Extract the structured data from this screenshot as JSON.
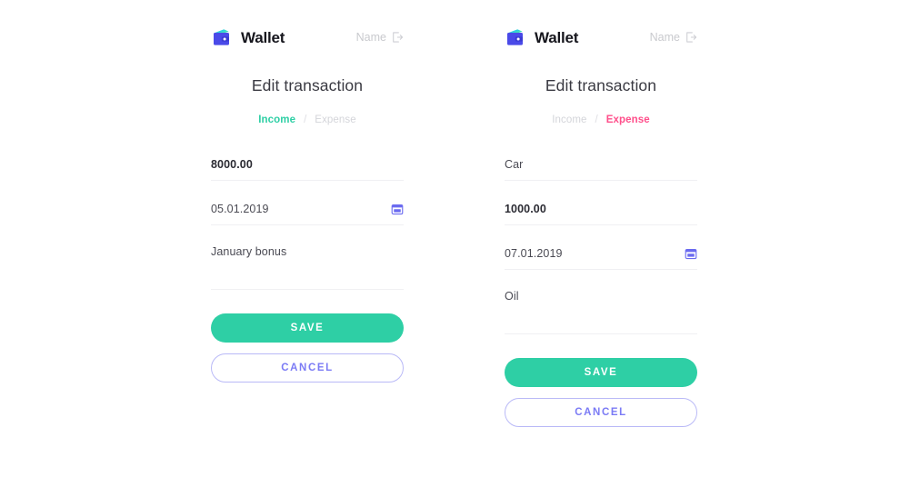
{
  "brand": {
    "name": "Wallet",
    "logo_icon": "wallet-icon"
  },
  "user": {
    "name": "Name",
    "logout_icon": "logout-icon"
  },
  "colors": {
    "income_accent": "#2ecfa5",
    "expense_accent": "#ff4f8b",
    "save_button": "#2ecfa5",
    "cancel_border": "#b9b9f7",
    "cancel_text": "#7b7bf5",
    "calendar_icon": "#6b6bf0",
    "muted_text": "#d4d5da",
    "field_underline": "#f0f0f3"
  },
  "panels": [
    {
      "id": "income-panel",
      "title": "Edit transaction",
      "tabs": [
        {
          "label": "Income",
          "state": "active",
          "accent": "income"
        },
        {
          "label": "Expense",
          "state": "inactive",
          "accent": "muted"
        }
      ],
      "separator": "/",
      "fields": [
        {
          "name": "amount",
          "value": "8000.00",
          "bold": true,
          "icon": null,
          "tall": false
        },
        {
          "name": "date",
          "value": "05.01.2019",
          "bold": false,
          "icon": "calendar-icon",
          "tall": false
        },
        {
          "name": "comment",
          "value": "January bonus",
          "bold": false,
          "icon": null,
          "tall": true
        }
      ],
      "buttons": {
        "save": "SAVE",
        "cancel": "CANCEL"
      }
    },
    {
      "id": "expense-panel",
      "title": "Edit transaction",
      "tabs": [
        {
          "label": "Income",
          "state": "inactive",
          "accent": "muted"
        },
        {
          "label": "Expense",
          "state": "active",
          "accent": "expense"
        }
      ],
      "separator": "/",
      "fields": [
        {
          "name": "category",
          "value": "Car",
          "bold": false,
          "icon": null,
          "tall": false
        },
        {
          "name": "amount",
          "value": "1000.00",
          "bold": true,
          "icon": null,
          "tall": false
        },
        {
          "name": "date",
          "value": "07.01.2019",
          "bold": false,
          "icon": "calendar-icon",
          "tall": false
        },
        {
          "name": "comment",
          "value": "Oil",
          "bold": false,
          "icon": null,
          "tall": true
        }
      ],
      "buttons": {
        "save": "SAVE",
        "cancel": "CANCEL"
      }
    }
  ]
}
